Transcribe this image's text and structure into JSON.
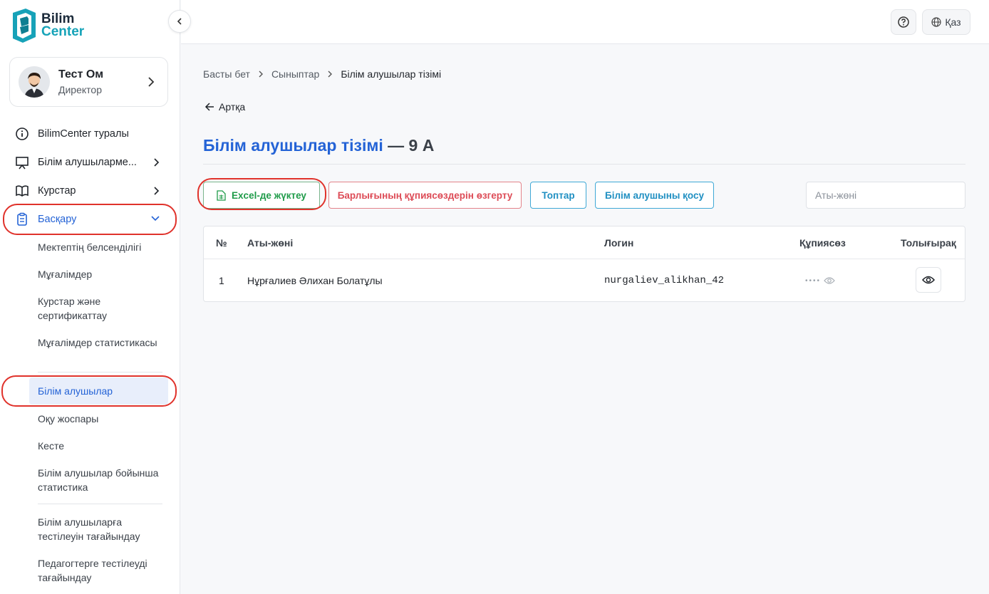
{
  "brand": {
    "line1": "Bilim",
    "line2": "Center"
  },
  "profile": {
    "name": "Тест Ом",
    "role": "Директор"
  },
  "sidebar": {
    "items": [
      {
        "label": "BilimCenter туралы",
        "icon": "info-icon"
      },
      {
        "label": "Білім алушыларме...",
        "icon": "presentation-icon"
      },
      {
        "label": "Курстар",
        "icon": "book-icon"
      },
      {
        "label": "Басқару",
        "icon": "clipboard-icon"
      }
    ],
    "subitems": [
      "Мектептің белсенділігі",
      "Мұғалімдер",
      "Курстар және сертификаттау",
      "Мұғалімдер статистикасы",
      "Білім алушылар",
      "Оқу жоспары",
      "Кесте",
      "Білім алушылар бойынша статистика",
      "Білім алушыларға тестілеуін тағайындау",
      "Педагогтерге тестілеуді тағайындау"
    ]
  },
  "topbar": {
    "language": "Қаз"
  },
  "breadcrumb": [
    "Басты бет",
    "Сыныптар",
    "Білім алушылар тізімі"
  ],
  "back_label": "Артқа",
  "page_title": {
    "main": "Білім алушылар тізімі",
    "suffix": "— 9 А"
  },
  "actions": {
    "excel": "Excel-де жүктеу",
    "reset_passwords": "Барлығының құпиясөздерін өзгерту",
    "groups": "Топтар",
    "add_student": "Білім алушыны қосу"
  },
  "search": {
    "placeholder": "Аты-жөні"
  },
  "table": {
    "columns": [
      "№",
      "Аты-жөні",
      "Логин",
      "Құпиясөз",
      "Толығырақ"
    ],
    "rows": [
      {
        "num": "1",
        "name": "Нұрғалиев Әлихан Болатұлы",
        "login": "nurgaliev_alikhan_42",
        "password": "••••"
      }
    ]
  },
  "colors": {
    "accent": "#2463d6",
    "green": "#1f9b49",
    "red": "#dd4c57",
    "blue": "#1f8fc2",
    "highlight_ring": "#e0322b"
  }
}
